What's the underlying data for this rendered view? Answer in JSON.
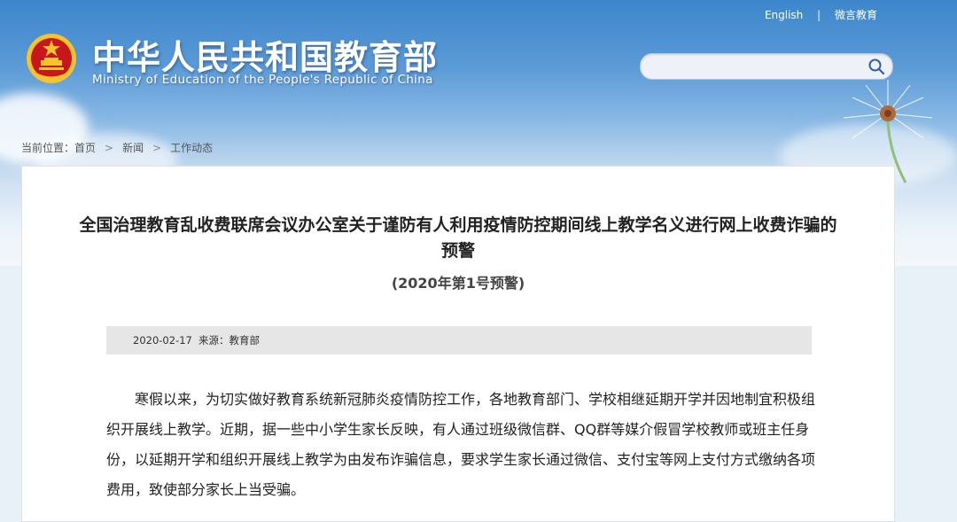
{
  "header": {
    "title": "中华人民共和国教育部",
    "subtitle": "Ministry of Education of the People's Republic of China",
    "links": {
      "english": "English",
      "weibo": "微言教育",
      "separator": "|"
    },
    "search": {
      "placeholder": "",
      "icon": "search-icon"
    },
    "emblem": "national-emblem-icon"
  },
  "breadcrumb": {
    "prefix": "当前位置：",
    "items": [
      "首页",
      "新闻",
      "工作动态"
    ],
    "separator": ">"
  },
  "article": {
    "title": "全国治理教育乱收费联席会议办公室关于谨防有人利用疫情防控期间线上教学名义进行网上收费诈骗的预警",
    "subtitle": "(2020年第1号预警)",
    "date": "2020-02-17",
    "source": "来源：教育部",
    "body": "寒假以来，为切实做好教育系统新冠肺炎疫情防控工作，各地教育部门、学校相继延期开学并因地制宜积极组织开展线上教学。近期，据一些中小学生家长反映，有人通过班级微信群、QQ群等媒介假冒学校教师或班主任身份，以延期开学和组织开展线上教学为由发布诈骗信息，要求学生家长通过微信、支付宝等网上支付方式缴纳各项费用，致使部分家长上当受骗。"
  },
  "colors": {
    "sky_top": "#3d86cc",
    "emblem_red": "#c8161d",
    "emblem_gold": "#f4c430"
  }
}
